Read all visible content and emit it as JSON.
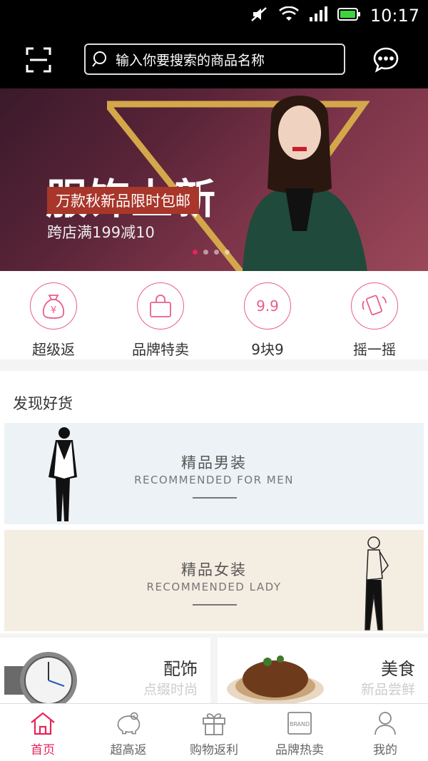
{
  "status_bar": {
    "time": "10:17"
  },
  "header": {
    "search_placeholder": "输入你要搜索的商品名称"
  },
  "banner": {
    "headline": "服饰上新",
    "tag": "万款秋新品限时包邮",
    "promo": "跨店满199减10",
    "slides": 4,
    "active_slide": 1
  },
  "quick_nav": [
    {
      "label": "超级返",
      "icon": "money-bag-icon"
    },
    {
      "label": "品牌特卖",
      "icon": "shopping-bag-icon"
    },
    {
      "label": "9块9",
      "icon": "nine-nine-icon"
    },
    {
      "label": "摇一摇",
      "icon": "shake-phone-icon"
    }
  ],
  "discover": {
    "title": "发现好货",
    "men": {
      "cn": "精品男装",
      "en": "RECOMMENDED FOR MEN"
    },
    "lady": {
      "cn": "精品女装",
      "en": "RECOMMENDED LADY"
    }
  },
  "promo_cards": [
    {
      "title": "配饰",
      "subtitle": "点缀时尚"
    },
    {
      "title": "美食",
      "subtitle": "新品尝鲜"
    }
  ],
  "tabs": [
    {
      "label": "首页",
      "icon": "home-icon",
      "active": true
    },
    {
      "label": "超高返",
      "icon": "piggy-bank-icon",
      "active": false
    },
    {
      "label": "购物返利",
      "icon": "gift-icon",
      "active": false
    },
    {
      "label": "品牌热卖",
      "icon": "brand-icon",
      "icon_text": "BRAND",
      "active": false
    },
    {
      "label": "我的",
      "icon": "user-icon",
      "active": false
    }
  ],
  "colors": {
    "accent": "#e8245c",
    "icon_pink": "#e85e8b"
  }
}
